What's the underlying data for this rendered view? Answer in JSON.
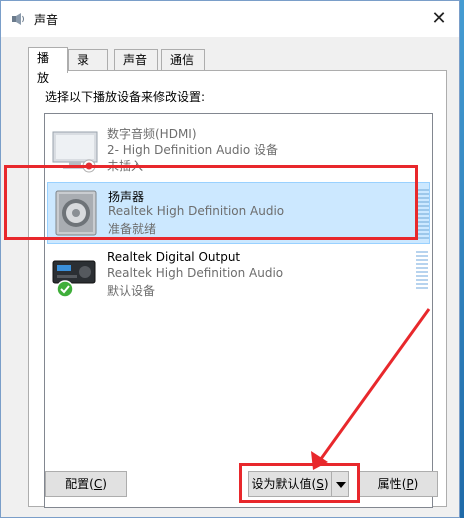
{
  "window": {
    "title": "声音",
    "close_glyph": "✕"
  },
  "tabs": [
    {
      "label": "播放",
      "active": true
    },
    {
      "label": "录制",
      "active": false
    },
    {
      "label": "声音",
      "active": false
    },
    {
      "label": "通信",
      "active": false
    }
  ],
  "instruction": "选择以下播放设备来修改设置:",
  "devices": [
    {
      "name": "数字音频(HDMI)",
      "driver": "2- High Definition Audio 设备",
      "status": "未插入",
      "icon": "monitor-icon",
      "selected": false
    },
    {
      "name": "扬声器",
      "driver": "Realtek High Definition Audio",
      "status": "准备就绪",
      "icon": "speaker-icon",
      "selected": true
    },
    {
      "name": "Realtek Digital Output",
      "driver": "Realtek High Definition Audio",
      "status": "默认设备",
      "icon": "receiver-icon",
      "selected": false
    }
  ],
  "buttons": {
    "configure": {
      "text": "配置",
      "mnemonic": "C"
    },
    "set_default": {
      "text": "设为默认值",
      "mnemonic": "S"
    },
    "properties": {
      "text": "属性",
      "mnemonic": "P"
    }
  },
  "annotation_color": "#e8282c"
}
